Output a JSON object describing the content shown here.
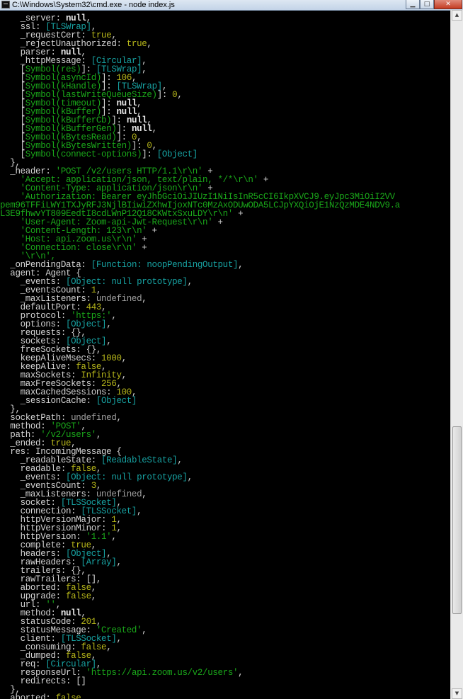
{
  "window": {
    "title": "C:\\Windows\\System32\\cmd.exe - node  index.js",
    "minimize_icon": "minimize-icon",
    "maximize_icon": "maximize-icon",
    "close_icon": "close-icon",
    "colors": {
      "background": "#000000",
      "text": "#d4d4d4",
      "string": "#1aa81a",
      "number": "#b8b81a",
      "special": "#17a2a2"
    }
  },
  "console": {
    "lines": [
      [
        {
          "t": "    _server: ",
          "s": "key"
        },
        {
          "t": "null",
          "s": "null"
        },
        {
          "t": ",",
          "s": "punc"
        }
      ],
      [
        {
          "t": "    ssl: ",
          "s": "key"
        },
        {
          "t": "[TLSWrap]",
          "s": "special"
        },
        {
          "t": ",",
          "s": "punc"
        }
      ],
      [
        {
          "t": "    _requestCert: ",
          "s": "key"
        },
        {
          "t": "true",
          "s": "bool"
        },
        {
          "t": ",",
          "s": "punc"
        }
      ],
      [
        {
          "t": "    _rejectUnauthorized: ",
          "s": "key"
        },
        {
          "t": "true",
          "s": "bool"
        },
        {
          "t": ",",
          "s": "punc"
        }
      ],
      [
        {
          "t": "    parser: ",
          "s": "key"
        },
        {
          "t": "null",
          "s": "null"
        },
        {
          "t": ",",
          "s": "punc"
        }
      ],
      [
        {
          "t": "    _httpMessage: ",
          "s": "key"
        },
        {
          "t": "[Circular]",
          "s": "special"
        },
        {
          "t": ",",
          "s": "punc"
        }
      ],
      [
        {
          "t": "    [",
          "s": "punc"
        },
        {
          "t": "Symbol(res)",
          "s": "sym"
        },
        {
          "t": "]: ",
          "s": "punc"
        },
        {
          "t": "[TLSWrap]",
          "s": "special"
        },
        {
          "t": ",",
          "s": "punc"
        }
      ],
      [
        {
          "t": "    [",
          "s": "punc"
        },
        {
          "t": "Symbol(asyncId)",
          "s": "sym"
        },
        {
          "t": "]: ",
          "s": "punc"
        },
        {
          "t": "106",
          "s": "num"
        },
        {
          "t": ",",
          "s": "punc"
        }
      ],
      [
        {
          "t": "    [",
          "s": "punc"
        },
        {
          "t": "Symbol(kHandle)",
          "s": "sym"
        },
        {
          "t": "]: ",
          "s": "punc"
        },
        {
          "t": "[TLSWrap]",
          "s": "special"
        },
        {
          "t": ",",
          "s": "punc"
        }
      ],
      [
        {
          "t": "    [",
          "s": "punc"
        },
        {
          "t": "Symbol(lastWriteQueueSize)",
          "s": "sym"
        },
        {
          "t": "]: ",
          "s": "punc"
        },
        {
          "t": "0",
          "s": "num"
        },
        {
          "t": ",",
          "s": "punc"
        }
      ],
      [
        {
          "t": "    [",
          "s": "punc"
        },
        {
          "t": "Symbol(timeout)",
          "s": "sym"
        },
        {
          "t": "]: ",
          "s": "punc"
        },
        {
          "t": "null",
          "s": "null"
        },
        {
          "t": ",",
          "s": "punc"
        }
      ],
      [
        {
          "t": "    [",
          "s": "punc"
        },
        {
          "t": "Symbol(kBuffer)",
          "s": "sym"
        },
        {
          "t": "]: ",
          "s": "punc"
        },
        {
          "t": "null",
          "s": "null"
        },
        {
          "t": ",",
          "s": "punc"
        }
      ],
      [
        {
          "t": "    [",
          "s": "punc"
        },
        {
          "t": "Symbol(kBufferCb)",
          "s": "sym"
        },
        {
          "t": "]: ",
          "s": "punc"
        },
        {
          "t": "null",
          "s": "null"
        },
        {
          "t": ",",
          "s": "punc"
        }
      ],
      [
        {
          "t": "    [",
          "s": "punc"
        },
        {
          "t": "Symbol(kBufferGen)",
          "s": "sym"
        },
        {
          "t": "]: ",
          "s": "punc"
        },
        {
          "t": "null",
          "s": "null"
        },
        {
          "t": ",",
          "s": "punc"
        }
      ],
      [
        {
          "t": "    [",
          "s": "punc"
        },
        {
          "t": "Symbol(kBytesRead)",
          "s": "sym"
        },
        {
          "t": "]: ",
          "s": "punc"
        },
        {
          "t": "0",
          "s": "num"
        },
        {
          "t": ",",
          "s": "punc"
        }
      ],
      [
        {
          "t": "    [",
          "s": "punc"
        },
        {
          "t": "Symbol(kBytesWritten)",
          "s": "sym"
        },
        {
          "t": "]: ",
          "s": "punc"
        },
        {
          "t": "0",
          "s": "num"
        },
        {
          "t": ",",
          "s": "punc"
        }
      ],
      [
        {
          "t": "    [",
          "s": "punc"
        },
        {
          "t": "Symbol(connect-options)",
          "s": "sym"
        },
        {
          "t": "]: ",
          "s": "punc"
        },
        {
          "t": "[Object]",
          "s": "special"
        }
      ],
      [
        {
          "t": "  },",
          "s": "punc"
        }
      ],
      [
        {
          "t": "  _header: ",
          "s": "key"
        },
        {
          "t": "'POST /v2/users HTTP/1.1\\r\\n'",
          "s": "str"
        },
        {
          "t": " +",
          "s": "punc"
        }
      ],
      [
        {
          "t": "    'Accept: application/json, text/plain, */*\\r\\n'",
          "s": "str"
        },
        {
          "t": " +",
          "s": "punc"
        }
      ],
      [
        {
          "t": "    'Content-Type: application/json\\r\\n'",
          "s": "str"
        },
        {
          "t": " +",
          "s": "punc"
        }
      ],
      [
        {
          "t": "    'Authorization: Bearer eyJhbGciOiJIUzI1NiIsInR5cCI6IkpXVCJ9.eyJpc3MiOiI2VV",
          "s": "str"
        }
      ],
      [
        {
          "t": "pem96TFFiLWY1TXJyRFJ3NjlBIiwiZXhwIjoxNTc0MzAxODUwODA5LCJpYXQiOjE1NzQzMDE4NDV9.a",
          "s": "str"
        }
      ],
      [
        {
          "t": "L3E9fhwvYT809EedtI8cdLWnP12Q18CKWtxSxuLDY\\r\\n'",
          "s": "str"
        },
        {
          "t": " +",
          "s": "punc"
        }
      ],
      [
        {
          "t": "    'User-Agent: Zoom-api-Jwt-Request\\r\\n'",
          "s": "str"
        },
        {
          "t": " +",
          "s": "punc"
        }
      ],
      [
        {
          "t": "    'Content-Length: 123\\r\\n'",
          "s": "str"
        },
        {
          "t": " +",
          "s": "punc"
        }
      ],
      [
        {
          "t": "    'Host: api.zoom.us\\r\\n'",
          "s": "str"
        },
        {
          "t": " +",
          "s": "punc"
        }
      ],
      [
        {
          "t": "    'Connection: close\\r\\n'",
          "s": "str"
        },
        {
          "t": " +",
          "s": "punc"
        }
      ],
      [
        {
          "t": "    '\\r\\n',",
          "s": "str"
        }
      ],
      [
        {
          "t": "  _onPendingData: ",
          "s": "key"
        },
        {
          "t": "[Function: noopPendingOutput]",
          "s": "special"
        },
        {
          "t": ",",
          "s": "punc"
        }
      ],
      [
        {
          "t": "  agent: Agent {",
          "s": "key"
        }
      ],
      [
        {
          "t": "    _events: ",
          "s": "key"
        },
        {
          "t": "[Object: null prototype]",
          "s": "special"
        },
        {
          "t": ",",
          "s": "punc"
        }
      ],
      [
        {
          "t": "    _eventsCount: ",
          "s": "key"
        },
        {
          "t": "1",
          "s": "num"
        },
        {
          "t": ",",
          "s": "punc"
        }
      ],
      [
        {
          "t": "    _maxListeners: ",
          "s": "key"
        },
        {
          "t": "undefined",
          "s": "undef"
        },
        {
          "t": ",",
          "s": "punc"
        }
      ],
      [
        {
          "t": "    defaultPort: ",
          "s": "key"
        },
        {
          "t": "443",
          "s": "num"
        },
        {
          "t": ",",
          "s": "punc"
        }
      ],
      [
        {
          "t": "    protocol: ",
          "s": "key"
        },
        {
          "t": "'https:'",
          "s": "str"
        },
        {
          "t": ",",
          "s": "punc"
        }
      ],
      [
        {
          "t": "    options: ",
          "s": "key"
        },
        {
          "t": "[Object]",
          "s": "special"
        },
        {
          "t": ",",
          "s": "punc"
        }
      ],
      [
        {
          "t": "    requests: {},",
          "s": "key"
        }
      ],
      [
        {
          "t": "    sockets: ",
          "s": "key"
        },
        {
          "t": "[Object]",
          "s": "special"
        },
        {
          "t": ",",
          "s": "punc"
        }
      ],
      [
        {
          "t": "    freeSockets: {},",
          "s": "key"
        }
      ],
      [
        {
          "t": "    keepAliveMsecs: ",
          "s": "key"
        },
        {
          "t": "1000",
          "s": "num"
        },
        {
          "t": ",",
          "s": "punc"
        }
      ],
      [
        {
          "t": "    keepAlive: ",
          "s": "key"
        },
        {
          "t": "false",
          "s": "bool"
        },
        {
          "t": ",",
          "s": "punc"
        }
      ],
      [
        {
          "t": "    maxSockets: ",
          "s": "key"
        },
        {
          "t": "Infinity",
          "s": "num"
        },
        {
          "t": ",",
          "s": "punc"
        }
      ],
      [
        {
          "t": "    maxFreeSockets: ",
          "s": "key"
        },
        {
          "t": "256",
          "s": "num"
        },
        {
          "t": ",",
          "s": "punc"
        }
      ],
      [
        {
          "t": "    maxCachedSessions: ",
          "s": "key"
        },
        {
          "t": "100",
          "s": "num"
        },
        {
          "t": ",",
          "s": "punc"
        }
      ],
      [
        {
          "t": "    _sessionCache: ",
          "s": "key"
        },
        {
          "t": "[Object]",
          "s": "special"
        }
      ],
      [
        {
          "t": "  },",
          "s": "punc"
        }
      ],
      [
        {
          "t": "  socketPath: ",
          "s": "key"
        },
        {
          "t": "undefined",
          "s": "undef"
        },
        {
          "t": ",",
          "s": "punc"
        }
      ],
      [
        {
          "t": "  method: ",
          "s": "key"
        },
        {
          "t": "'POST'",
          "s": "str"
        },
        {
          "t": ",",
          "s": "punc"
        }
      ],
      [
        {
          "t": "  path: ",
          "s": "key"
        },
        {
          "t": "'/v2/users'",
          "s": "str"
        },
        {
          "t": ",",
          "s": "punc"
        }
      ],
      [
        {
          "t": "  _ended: ",
          "s": "key"
        },
        {
          "t": "true",
          "s": "bool"
        },
        {
          "t": ",",
          "s": "punc"
        }
      ],
      [
        {
          "t": "  res: IncomingMessage {",
          "s": "key"
        }
      ],
      [
        {
          "t": "    _readableState: ",
          "s": "key"
        },
        {
          "t": "[ReadableState]",
          "s": "special"
        },
        {
          "t": ",",
          "s": "punc"
        }
      ],
      [
        {
          "t": "    readable: ",
          "s": "key"
        },
        {
          "t": "false",
          "s": "bool"
        },
        {
          "t": ",",
          "s": "punc"
        }
      ],
      [
        {
          "t": "    _events: ",
          "s": "key"
        },
        {
          "t": "[Object: null prototype]",
          "s": "special"
        },
        {
          "t": ",",
          "s": "punc"
        }
      ],
      [
        {
          "t": "    _eventsCount: ",
          "s": "key"
        },
        {
          "t": "3",
          "s": "num"
        },
        {
          "t": ",",
          "s": "punc"
        }
      ],
      [
        {
          "t": "    _maxListeners: ",
          "s": "key"
        },
        {
          "t": "undefined",
          "s": "undef"
        },
        {
          "t": ",",
          "s": "punc"
        }
      ],
      [
        {
          "t": "    socket: ",
          "s": "key"
        },
        {
          "t": "[TLSSocket]",
          "s": "special"
        },
        {
          "t": ",",
          "s": "punc"
        }
      ],
      [
        {
          "t": "    connection: ",
          "s": "key"
        },
        {
          "t": "[TLSSocket]",
          "s": "special"
        },
        {
          "t": ",",
          "s": "punc"
        }
      ],
      [
        {
          "t": "    httpVersionMajor: ",
          "s": "key"
        },
        {
          "t": "1",
          "s": "num"
        },
        {
          "t": ",",
          "s": "punc"
        }
      ],
      [
        {
          "t": "    httpVersionMinor: ",
          "s": "key"
        },
        {
          "t": "1",
          "s": "num"
        },
        {
          "t": ",",
          "s": "punc"
        }
      ],
      [
        {
          "t": "    httpVersion: ",
          "s": "key"
        },
        {
          "t": "'1.1'",
          "s": "str"
        },
        {
          "t": ",",
          "s": "punc"
        }
      ],
      [
        {
          "t": "    complete: ",
          "s": "key"
        },
        {
          "t": "true",
          "s": "bool"
        },
        {
          "t": ",",
          "s": "punc"
        }
      ],
      [
        {
          "t": "    headers: ",
          "s": "key"
        },
        {
          "t": "[Object]",
          "s": "special"
        },
        {
          "t": ",",
          "s": "punc"
        }
      ],
      [
        {
          "t": "    rawHeaders: ",
          "s": "key"
        },
        {
          "t": "[Array]",
          "s": "special"
        },
        {
          "t": ",",
          "s": "punc"
        }
      ],
      [
        {
          "t": "    trailers: {},",
          "s": "key"
        }
      ],
      [
        {
          "t": "    rawTrailers: [],",
          "s": "key"
        }
      ],
      [
        {
          "t": "    aborted: ",
          "s": "key"
        },
        {
          "t": "false",
          "s": "bool"
        },
        {
          "t": ",",
          "s": "punc"
        }
      ],
      [
        {
          "t": "    upgrade: ",
          "s": "key"
        },
        {
          "t": "false",
          "s": "bool"
        },
        {
          "t": ",",
          "s": "punc"
        }
      ],
      [
        {
          "t": "    url: ",
          "s": "key"
        },
        {
          "t": "''",
          "s": "str"
        },
        {
          "t": ",",
          "s": "punc"
        }
      ],
      [
        {
          "t": "    method: ",
          "s": "key"
        },
        {
          "t": "null",
          "s": "null"
        },
        {
          "t": ",",
          "s": "punc"
        }
      ],
      [
        {
          "t": "    statusCode: ",
          "s": "key"
        },
        {
          "t": "201",
          "s": "num"
        },
        {
          "t": ",",
          "s": "punc"
        }
      ],
      [
        {
          "t": "    statusMessage: ",
          "s": "key"
        },
        {
          "t": "'Created'",
          "s": "str"
        },
        {
          "t": ",",
          "s": "punc"
        }
      ],
      [
        {
          "t": "    client: ",
          "s": "key"
        },
        {
          "t": "[TLSSocket]",
          "s": "special"
        },
        {
          "t": ",",
          "s": "punc"
        }
      ],
      [
        {
          "t": "    _consuming: ",
          "s": "key"
        },
        {
          "t": "false",
          "s": "bool"
        },
        {
          "t": ",",
          "s": "punc"
        }
      ],
      [
        {
          "t": "    _dumped: ",
          "s": "key"
        },
        {
          "t": "false",
          "s": "bool"
        },
        {
          "t": ",",
          "s": "punc"
        }
      ],
      [
        {
          "t": "    req: ",
          "s": "key"
        },
        {
          "t": "[Circular]",
          "s": "special"
        },
        {
          "t": ",",
          "s": "punc"
        }
      ],
      [
        {
          "t": "    responseUrl: ",
          "s": "key"
        },
        {
          "t": "'https://api.zoom.us/v2/users'",
          "s": "str"
        },
        {
          "t": ",",
          "s": "punc"
        }
      ],
      [
        {
          "t": "    redirects: []",
          "s": "key"
        }
      ],
      [
        {
          "t": "  },",
          "s": "punc"
        }
      ],
      [
        {
          "t": "  aborted: ",
          "s": "key"
        },
        {
          "t": "false",
          "s": "bool"
        },
        {
          "t": ",",
          "s": "punc"
        }
      ]
    ]
  },
  "scrollbar": {
    "up_icon": "scroll-up-arrow-icon",
    "down_icon": "scroll-down-arrow-icon",
    "position": 0.6
  }
}
